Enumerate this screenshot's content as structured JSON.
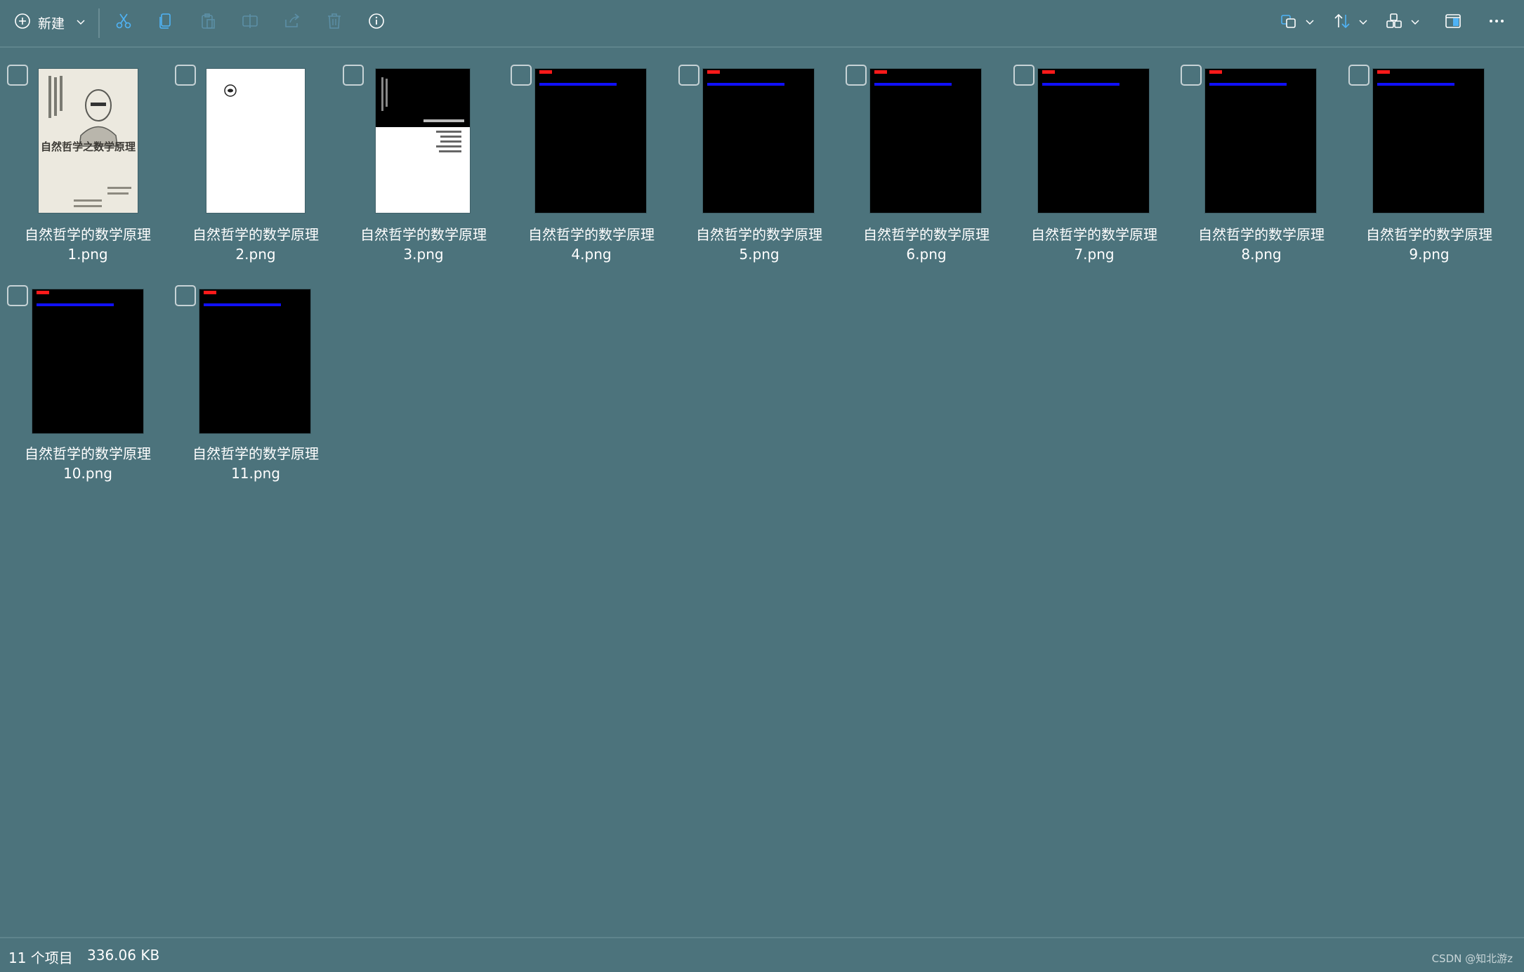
{
  "toolbar": {
    "new_label": "新建",
    "icons": [
      "plus-circle-icon",
      "chevron-down-icon",
      "cut-icon",
      "copy-icon",
      "paste-icon",
      "rename-icon",
      "share-icon",
      "delete-icon",
      "info-icon",
      "sort-icon",
      "view-icon",
      "details-icon",
      "more-icon"
    ],
    "accent": "#4fb3f6"
  },
  "files": [
    {
      "name_line1": "自然哲学的数学原理",
      "name_line2": "1.png",
      "thumb": "cover"
    },
    {
      "name_line1": "自然哲学的数学原理",
      "name_line2": "2.png",
      "thumb": "white"
    },
    {
      "name_line1": "自然哲学的数学原理",
      "name_line2": "3.png",
      "thumb": "split"
    },
    {
      "name_line1": "自然哲学的数学原理",
      "name_line2": "4.png",
      "thumb": "black"
    },
    {
      "name_line1": "自然哲学的数学原理",
      "name_line2": "5.png",
      "thumb": "black"
    },
    {
      "name_line1": "自然哲学的数学原理",
      "name_line2": "6.png",
      "thumb": "black"
    },
    {
      "name_line1": "自然哲学的数学原理",
      "name_line2": "7.png",
      "thumb": "black"
    },
    {
      "name_line1": "自然哲学的数学原理",
      "name_line2": "8.png",
      "thumb": "black"
    },
    {
      "name_line1": "自然哲学的数学原理",
      "name_line2": "9.png",
      "thumb": "black"
    },
    {
      "name_line1": "自然哲学的数学原理",
      "name_line2": "10.png",
      "thumb": "black"
    },
    {
      "name_line1": "自然哲学的数学原理",
      "name_line2": "11.png",
      "thumb": "black"
    }
  ],
  "cover": {
    "title": "自然哲学之数学原理"
  },
  "status": {
    "count": "11 个项目",
    "size": "336.06 KB",
    "watermark": "CSDN @知北游z"
  },
  "colors": {
    "background": "#4c737c",
    "red_mark": "#ff1a1a",
    "blue_bar": "#1010ff"
  }
}
